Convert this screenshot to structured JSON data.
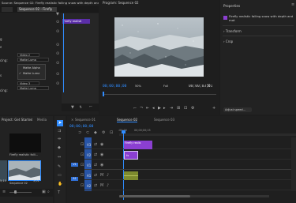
{
  "source_panel": {
    "title": "Source: Sequence 02: Firefly realistic falling snow with depth and mot",
    "tab": "Sequence 02 - Firefly",
    "clip_label": "Firefly realisti",
    "fields": [
      {
        "value": "Video 2"
      },
      {
        "value": "Matte Luma"
      },
      {
        "value": "Video 3"
      },
      {
        "value": "Matte Luma"
      }
    ],
    "field_labels": [
      "g",
      "cing:",
      "s",
      "cing:",
      "e"
    ],
    "dropdown_options": [
      "Matte Alpha",
      "Matte Luma"
    ]
  },
  "program_panel": {
    "title": "Program: Sequence 02",
    "timecode_left": "00;00;00;00",
    "zoom": "50%",
    "quality": "Full",
    "timecode_right": "00;00;03;01"
  },
  "properties_panel": {
    "title": "Properties",
    "item_name": "Firefly realistic falling snow with depth and mot",
    "sections": [
      "Transform",
      "Crop"
    ],
    "adjust_label": "Adjust speed..."
  },
  "project_panel": {
    "title": "Project: Get Started",
    "media_tab": "Media",
    "items": [
      {
        "name": "Firefly realistic falli...",
        "duration": ""
      },
      {
        "name": "Sequence 02",
        "duration": "3;01"
      }
    ],
    "left_item_duration": "5;15"
  },
  "timeline": {
    "tabs": [
      "Sequence 01",
      "Sequence 02",
      "Sequence 03"
    ],
    "active_tab_index": 1,
    "timecode": "00;00;00;00",
    "ruler_labels": [
      ":00;00",
      "00;00;00;15"
    ],
    "tracks": [
      {
        "name": "V3",
        "kind": "video"
      },
      {
        "name": "V2",
        "kind": "video"
      },
      {
        "name": "V1",
        "kind": "video"
      },
      {
        "name": "A1",
        "kind": "audio"
      },
      {
        "name": "A2",
        "kind": "audio"
      }
    ],
    "source_patch_labels": [
      "V1",
      "A1"
    ],
    "clips": [
      {
        "track": "V3",
        "label": "Firefly realis",
        "color": "#8b3fd1"
      },
      {
        "track": "V2",
        "label": "fx",
        "color": "#8b3fd1"
      },
      {
        "track": "A1",
        "label": "",
        "color": "#7d8a2e"
      }
    ]
  },
  "colors": {
    "accent_blue": "#2f8cff",
    "clip_purple": "#8b3fd1",
    "audio_olive": "#7d8a2e",
    "patch_blue": "#2f6fd6"
  }
}
